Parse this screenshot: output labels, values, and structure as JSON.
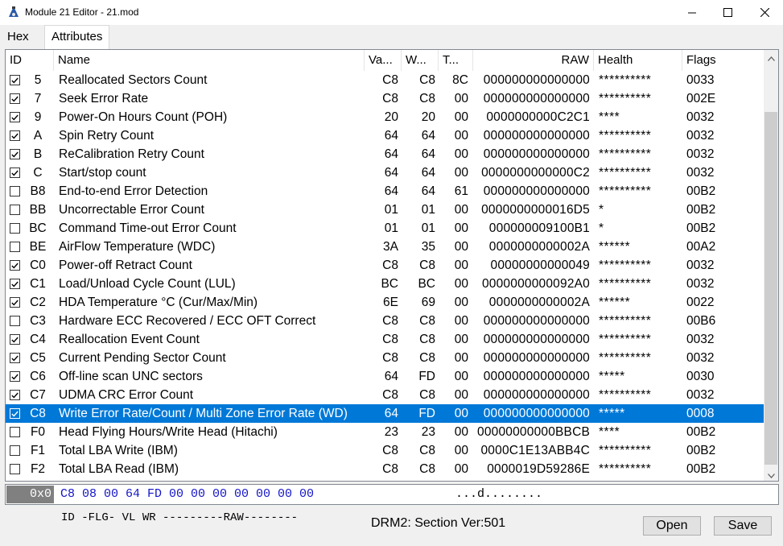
{
  "window": {
    "title": "Module 21 Editor - 21.mod",
    "minimize_icon": "minimize-icon",
    "maximize_icon": "maximize-icon",
    "close_icon": "close-icon"
  },
  "tabs": [
    {
      "label": "Hex",
      "active": false
    },
    {
      "label": "Attributes",
      "active": true
    }
  ],
  "columns": {
    "id": "ID",
    "name": "Name",
    "value": "Va...",
    "worst": "W...",
    "threshold": "T...",
    "raw": "RAW",
    "health": "Health",
    "flags": "Flags"
  },
  "rows": [
    {
      "checked": true,
      "id": "5",
      "name": "Reallocated Sectors Count",
      "value": "C8",
      "worst": "C8",
      "threshold": "8C",
      "raw": "000000000000000",
      "health": "**********",
      "flags": "0033"
    },
    {
      "checked": true,
      "id": "7",
      "name": "Seek Error Rate",
      "value": "C8",
      "worst": "C8",
      "threshold": "00",
      "raw": "000000000000000",
      "health": "**********",
      "flags": "002E"
    },
    {
      "checked": true,
      "id": "9",
      "name": "Power-On Hours Count (POH)",
      "value": "20",
      "worst": "20",
      "threshold": "00",
      "raw": "0000000000C2C1",
      "health": "****",
      "flags": "0032"
    },
    {
      "checked": true,
      "id": "A",
      "name": "Spin Retry Count",
      "value": "64",
      "worst": "64",
      "threshold": "00",
      "raw": "000000000000000",
      "health": "**********",
      "flags": "0032"
    },
    {
      "checked": true,
      "id": "B",
      "name": "ReCalibration Retry Count",
      "value": "64",
      "worst": "64",
      "threshold": "00",
      "raw": "000000000000000",
      "health": "**********",
      "flags": "0032"
    },
    {
      "checked": true,
      "id": "C",
      "name": "Start/stop count",
      "value": "64",
      "worst": "64",
      "threshold": "00",
      "raw": "0000000000000C2",
      "health": "**********",
      "flags": "0032"
    },
    {
      "checked": false,
      "id": "B8",
      "name": "End-to-end Error Detection",
      "value": "64",
      "worst": "64",
      "threshold": "61",
      "raw": "000000000000000",
      "health": "**********",
      "flags": "00B2"
    },
    {
      "checked": false,
      "id": "BB",
      "name": "Uncorrectable Error Count",
      "value": "01",
      "worst": "01",
      "threshold": "00",
      "raw": "0000000000016D5",
      "health": "*",
      "flags": "00B2"
    },
    {
      "checked": false,
      "id": "BC",
      "name": "Command Time-out Error Count",
      "value": "01",
      "worst": "01",
      "threshold": "00",
      "raw": "000000009100B1",
      "health": "*",
      "flags": "00B2"
    },
    {
      "checked": false,
      "id": "BE",
      "name": "AirFlow Temperature (WDC)",
      "value": "3A",
      "worst": "35",
      "threshold": "00",
      "raw": "0000000000002A",
      "health": "******",
      "flags": "00A2"
    },
    {
      "checked": true,
      "id": "C0",
      "name": "Power-off Retract Count",
      "value": "C8",
      "worst": "C8",
      "threshold": "00",
      "raw": "00000000000049",
      "health": "**********",
      "flags": "0032"
    },
    {
      "checked": true,
      "id": "C1",
      "name": "Load/Unload Cycle Count (LUL)",
      "value": "BC",
      "worst": "BC",
      "threshold": "00",
      "raw": "0000000000092A0",
      "health": "**********",
      "flags": "0032"
    },
    {
      "checked": true,
      "id": "C2",
      "name": "HDA Temperature °C (Cur/Max/Min)",
      "value": "6E",
      "worst": "69",
      "threshold": "00",
      "raw": "0000000000002A",
      "health": "******",
      "flags": "0022"
    },
    {
      "checked": false,
      "id": "C3",
      "name": "Hardware ECC Recovered / ECC OFT Correct",
      "value": "C8",
      "worst": "C8",
      "threshold": "00",
      "raw": "000000000000000",
      "health": "**********",
      "flags": "00B6"
    },
    {
      "checked": true,
      "id": "C4",
      "name": "Reallocation Event Count",
      "value": "C8",
      "worst": "C8",
      "threshold": "00",
      "raw": "000000000000000",
      "health": "**********",
      "flags": "0032"
    },
    {
      "checked": true,
      "id": "C5",
      "name": "Current Pending Sector Count",
      "value": "C8",
      "worst": "C8",
      "threshold": "00",
      "raw": "000000000000000",
      "health": "**********",
      "flags": "0032"
    },
    {
      "checked": true,
      "id": "C6",
      "name": "Off-line scan UNC sectors",
      "value": "64",
      "worst": "FD",
      "threshold": "00",
      "raw": "000000000000000",
      "health": "*****",
      "flags": "0030"
    },
    {
      "checked": true,
      "id": "C7",
      "name": "UDMA CRC Error Count",
      "value": "C8",
      "worst": "C8",
      "threshold": "00",
      "raw": "000000000000000",
      "health": "**********",
      "flags": "0032"
    },
    {
      "checked": true,
      "id": "C8",
      "name": "Write Error Rate/Count / Multi Zone Error Rate (WD)",
      "value": "64",
      "worst": "FD",
      "threshold": "00",
      "raw": "000000000000000",
      "health": "*****",
      "flags": "0008",
      "selected": true
    },
    {
      "checked": false,
      "id": "F0",
      "name": "Head Flying Hours/Write Head (Hitachi)",
      "value": "23",
      "worst": "23",
      "threshold": "00",
      "raw": "00000000000BBCB",
      "health": "****",
      "flags": "00B2"
    },
    {
      "checked": false,
      "id": "F1",
      "name": "Total LBA Write (IBM)",
      "value": "C8",
      "worst": "C8",
      "threshold": "00",
      "raw": "0000C1E13ABB4C",
      "health": "**********",
      "flags": "00B2"
    },
    {
      "checked": false,
      "id": "F2",
      "name": "Total LBA Read (IBM)",
      "value": "C8",
      "worst": "C8",
      "threshold": "00",
      "raw": "0000019D59286E",
      "health": "**********",
      "flags": "00B2"
    }
  ],
  "hex": {
    "offset": "0x0",
    "bytes": "C8 08 00 64 FD 00 00 00 00 00 00 00",
    "ascii": "...d........"
  },
  "legend": "ID -FLG- VL WR ---------RAW--------",
  "section_version": "DRM2: Section Ver:501",
  "buttons": {
    "open": "Open",
    "save": "Save"
  },
  "colors": {
    "selection": "#0078d7",
    "hex_bytes": "#1515c8"
  }
}
